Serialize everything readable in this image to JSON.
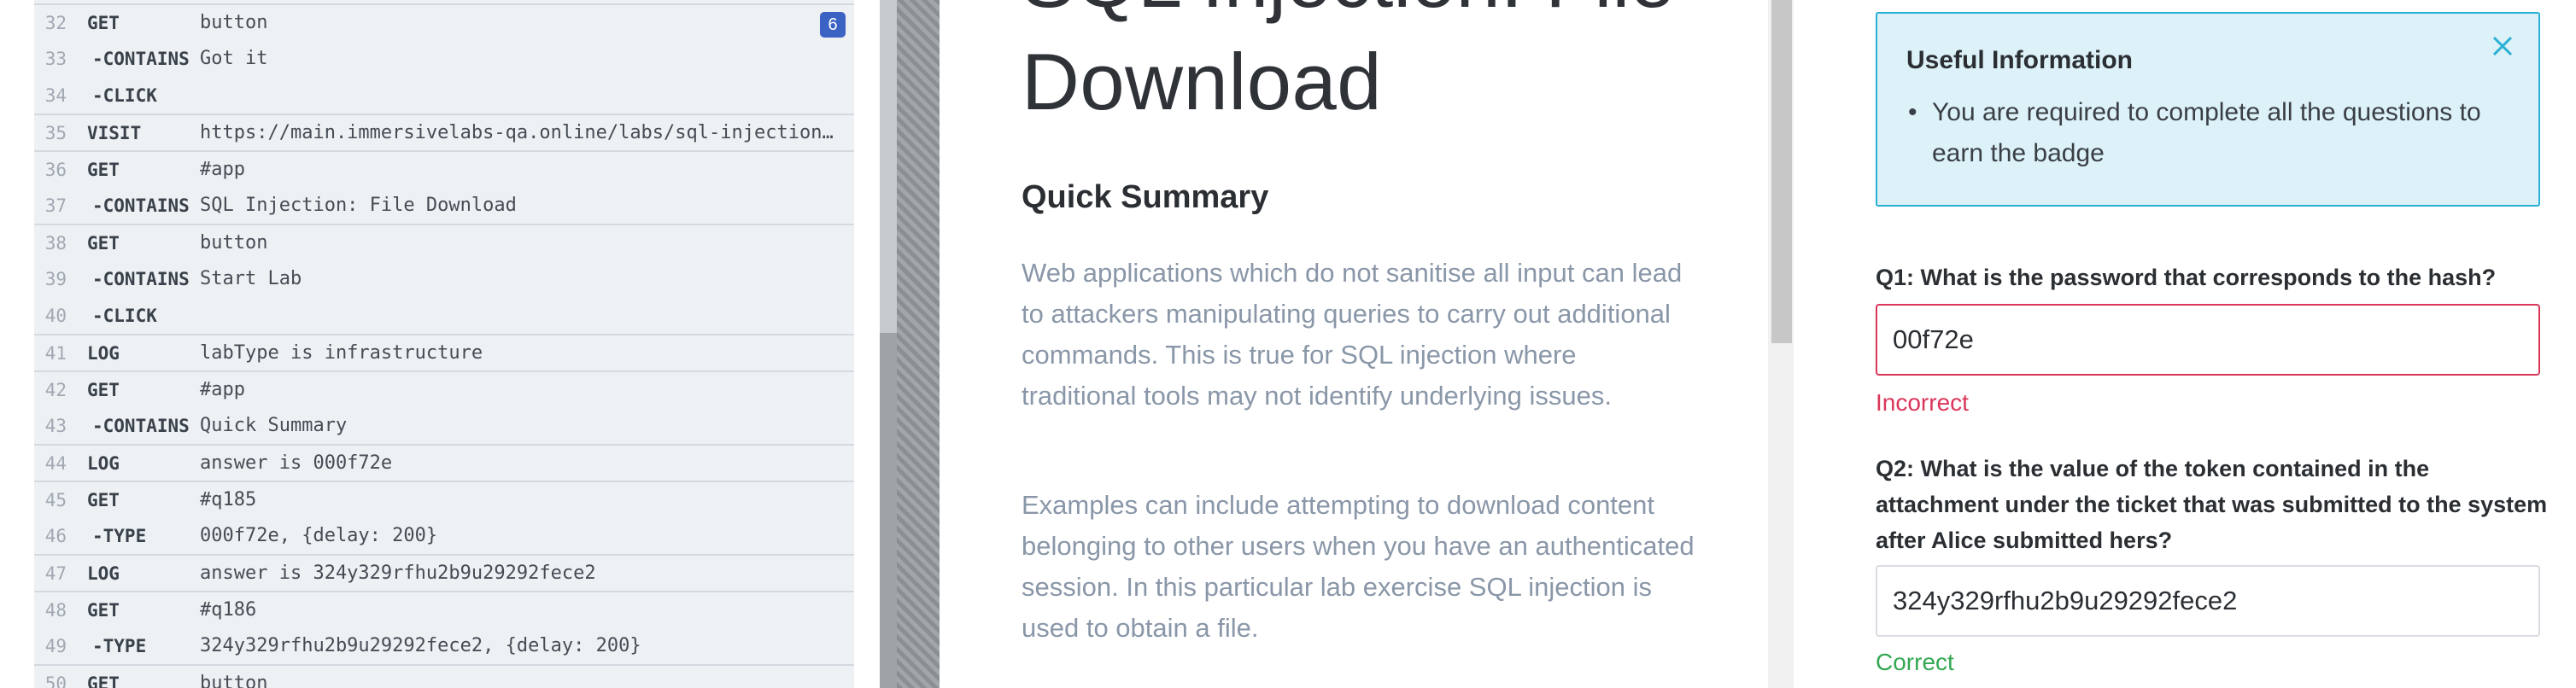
{
  "command_log": {
    "rows": [
      {
        "line": "32",
        "command": "GET",
        "message": "button",
        "child": false,
        "badge": "6"
      },
      {
        "line": "33",
        "command": "-CONTAINS",
        "message": "Got it",
        "child": true
      },
      {
        "line": "34",
        "command": "-CLICK",
        "message": "",
        "child": true
      },
      {
        "line": "35",
        "command": "VISIT",
        "message": "https://main.immersivelabs-qa.online/labs/sql-injection-file-download",
        "child": false
      },
      {
        "line": "36",
        "command": "GET",
        "message": "#app",
        "child": false
      },
      {
        "line": "37",
        "command": "-CONTAINS",
        "message": "SQL Injection: File Download",
        "child": true
      },
      {
        "line": "38",
        "command": "GET",
        "message": "button",
        "child": false
      },
      {
        "line": "39",
        "command": "-CONTAINS",
        "message": "Start Lab",
        "child": true
      },
      {
        "line": "40",
        "command": "-CLICK",
        "message": "",
        "child": true
      },
      {
        "line": "41",
        "command": "LOG",
        "message": "labType is infrastructure",
        "child": false
      },
      {
        "line": "42",
        "command": "GET",
        "message": "#app",
        "child": false
      },
      {
        "line": "43",
        "command": "-CONTAINS",
        "message": "Quick Summary",
        "child": true
      },
      {
        "line": "44",
        "command": "LOG",
        "message": "answer is 000f72e",
        "child": false
      },
      {
        "line": "45",
        "command": "GET",
        "message": "#q185",
        "child": false
      },
      {
        "line": "46",
        "command": "-TYPE",
        "message": "000f72e, {delay: 200}",
        "child": true
      },
      {
        "line": "47",
        "command": "LOG",
        "message": "answer is 324y329rfhu2b9u29292fece2",
        "child": false
      },
      {
        "line": "48",
        "command": "GET",
        "message": "#q186",
        "child": false
      },
      {
        "line": "49",
        "command": "-TYPE",
        "message": "324y329rfhu2b9u29292fece2, {delay: 200}",
        "child": true
      },
      {
        "line": "50",
        "command": "GET",
        "message": "button",
        "child": false
      }
    ]
  },
  "lab": {
    "title_prev": "SQL Injection: File",
    "title": "Download",
    "summary_heading": "Quick Summary",
    "paragraph1": "Web applications which do not sanitise all input can lead to attackers manipulating queries to carry out additional commands. This is true for SQL injection where traditional tools may not identify underlying issues.",
    "paragraph2": "Examples can include attempting to download content belonging to other users when you have an authenticated session. In this particular lab exercise SQL injection is used to obtain a file."
  },
  "info": {
    "title": "Useful Information",
    "items": [
      "You are required to complete all the questions to earn the badge"
    ]
  },
  "questions": {
    "q1": {
      "prefix": "Q1:",
      "text": "What is the password that corresponds to the hash?",
      "value": "00f72e",
      "status": "Incorrect"
    },
    "q2": {
      "prefix": "Q2:",
      "text": "What is the value of the token contained in the attachment under the ticket that was submitted to the system after Alice submitted hers?",
      "value": "324y329rfhu2b9u29292fece2",
      "status": "Correct"
    }
  },
  "colors": {
    "info_border": "#2ab0d4",
    "info_bg": "#dcf1f8",
    "error": "#d9365a",
    "success": "#34a853",
    "badge": "#3b63c4"
  },
  "icons": {
    "close": "close-icon"
  }
}
